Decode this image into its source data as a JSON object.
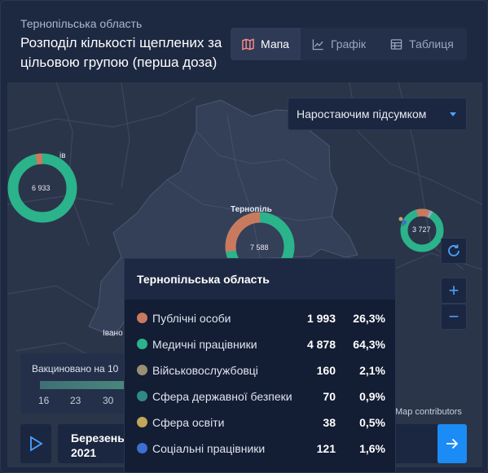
{
  "header": {
    "region": "Тернопільська область",
    "title": "Розподіл кількості щеплених за цільовою групою (перша доза)",
    "tabs": [
      {
        "label": "Мапа",
        "icon": "map-icon",
        "active": true
      },
      {
        "label": "Графік",
        "icon": "chart-line-icon",
        "active": false
      },
      {
        "label": "Таблиця",
        "icon": "table-icon",
        "active": false
      }
    ]
  },
  "map": {
    "mode_dropdown": "Наростаючим підсумком",
    "cities": [
      "Тернопіль",
      "Івано",
      "ів"
    ],
    "bubbles": [
      "6 933",
      "7 588",
      "3 727"
    ],
    "legend": {
      "title": "Вакциновано на 10",
      "ticks": [
        "16",
        "23",
        "30"
      ]
    },
    "attribution": "Map contributors",
    "timeline": {
      "month": "Березень",
      "year": "2021"
    }
  },
  "tooltip": {
    "title": "Тернопільська область",
    "rows": [
      {
        "label": "Публічні особи",
        "count": "1 993",
        "pct": "26,3%",
        "color": "#c97a5e"
      },
      {
        "label": "Медичні працівники",
        "count": "4 878",
        "pct": "64,3%",
        "color": "#2bb38b"
      },
      {
        "label": "Військовослужбовці",
        "count": "160",
        "pct": "2,1%",
        "color": "#9a8f76"
      },
      {
        "label": "Сфера державної безпеки",
        "count": "70",
        "pct": "0,9%",
        "color": "#2e8a86"
      },
      {
        "label": "Сфера освіти",
        "count": "38",
        "pct": "0,5%",
        "color": "#c4a65a"
      },
      {
        "label": "Соціальні працівники",
        "count": "121",
        "pct": "1,6%",
        "color": "#3b6fd1"
      }
    ]
  },
  "colors": {
    "accent": "#1b8bf5",
    "panel": "#1d2841",
    "map_bg": "#2a3449",
    "region_fill": "#323d56"
  }
}
